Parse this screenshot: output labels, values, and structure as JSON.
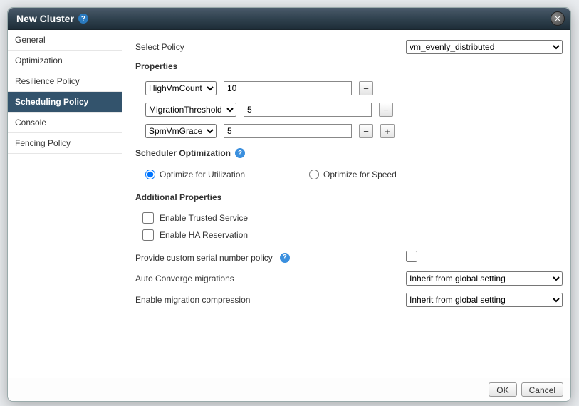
{
  "dialog": {
    "title": "New Cluster",
    "close_glyph": "✕"
  },
  "sidebar": {
    "items": [
      {
        "label": "General",
        "active": false
      },
      {
        "label": "Optimization",
        "active": false
      },
      {
        "label": "Resilience Policy",
        "active": false
      },
      {
        "label": "Scheduling Policy",
        "active": true
      },
      {
        "label": "Console",
        "active": false
      },
      {
        "label": "Fencing Policy",
        "active": false
      }
    ]
  },
  "main": {
    "select_policy_label": "Select Policy",
    "select_policy_value": "vm_evenly_distributed",
    "properties_title": "Properties",
    "properties": [
      {
        "name": "HighVmCount",
        "value": "10",
        "remove": true,
        "add": false
      },
      {
        "name": "MigrationThreshold",
        "value": "5",
        "remove": true,
        "add": false
      },
      {
        "name": "SpmVmGrace",
        "value": "5",
        "remove": true,
        "add": true
      }
    ],
    "scheduler_opt_title": "Scheduler Optimization",
    "radio": {
      "utilization": "Optimize for Utilization",
      "speed": "Optimize for Speed",
      "selected": "utilization"
    },
    "additional_title": "Additional Properties",
    "checkboxes": {
      "trusted": "Enable Trusted Service",
      "ha": "Enable HA Reservation"
    },
    "serial_label": "Provide custom serial number policy",
    "auto_converge_label": "Auto Converge migrations",
    "auto_converge_value": "Inherit from global setting",
    "compression_label": "Enable migration compression",
    "compression_value": "Inherit from global setting"
  },
  "footer": {
    "ok": "OK",
    "cancel": "Cancel"
  },
  "glyphs": {
    "help": "?",
    "minus": "−",
    "plus": "+"
  }
}
